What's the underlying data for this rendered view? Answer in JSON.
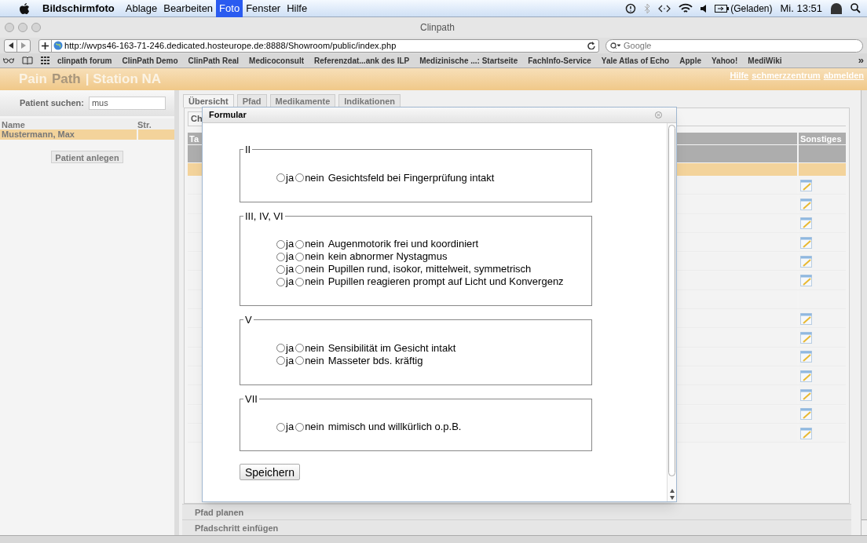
{
  "menu_bar": {
    "app": "Bildschirmfoto",
    "items": [
      {
        "label": "Ablage",
        "selected": false
      },
      {
        "label": "Bearbeiten",
        "selected": false
      },
      {
        "label": "Foto",
        "selected": true
      },
      {
        "label": "Fenster",
        "selected": false
      },
      {
        "label": "Hilfe",
        "selected": false
      }
    ],
    "battery": "(Geladen)",
    "clock": "Mi. 13:51"
  },
  "browser": {
    "title": "Clinpath",
    "url": "http://wvps46-163-71-246.dedicated.hosteurope.de:8888/Showroom/public/index.php",
    "search_placeholder": "Google",
    "bookmarks": [
      "clinpath forum",
      "ClinPath Demo",
      "ClinPath Real",
      "Medicoconsult",
      "Referenzdat...ank des ILP",
      "Medizinische ...: Startseite",
      "FachInfo-Service",
      "Yale Atlas of Echo",
      "Apple",
      "Yahoo!",
      "MediWiki"
    ],
    "more": "»"
  },
  "header": {
    "logo": [
      {
        "text": "Pain",
        "kind": "light"
      },
      {
        "text": "Path",
        "kind": "muted"
      },
      {
        "text": "| Station NA",
        "kind": "light"
      }
    ],
    "links": [
      "Hilfe",
      "schmerzzentrum",
      "abmelden"
    ]
  },
  "sidebar": {
    "search_label": "Patient suchen:",
    "search_value": "mus",
    "columns": [
      "Name",
      "Str."
    ],
    "rows": [
      {
        "name": "Mustermann, Max",
        "str": "",
        "selected": true
      }
    ],
    "button": "Patient anlegen"
  },
  "tabs": [
    {
      "label": "Übersicht",
      "selected": true
    },
    {
      "label": "Pfad",
      "selected": false
    },
    {
      "label": "Medikamente",
      "selected": false
    },
    {
      "label": "Indikationen",
      "selected": false
    }
  ],
  "inner_tab": "Ch",
  "table": {
    "columns": [
      "Ta",
      "Sonstiges"
    ],
    "rows": [
      {
        "selected": true,
        "edit": false
      },
      {
        "selected": false,
        "edit": true
      },
      {
        "selected": false,
        "edit": true
      },
      {
        "selected": false,
        "edit": true
      },
      {
        "selected": false,
        "edit": true
      },
      {
        "selected": false,
        "edit": true
      },
      {
        "selected": false,
        "edit": true
      },
      {
        "selected": false,
        "edit": false
      },
      {
        "selected": false,
        "edit": true
      },
      {
        "selected": false,
        "edit": true
      },
      {
        "selected": false,
        "edit": true
      },
      {
        "selected": false,
        "edit": true
      },
      {
        "selected": false,
        "edit": true
      },
      {
        "selected": false,
        "edit": true
      },
      {
        "selected": false,
        "edit": true
      }
    ]
  },
  "accordion": [
    "Pfad planen",
    "Pfadschritt einfügen"
  ],
  "dialog": {
    "title": "Formular",
    "sections": [
      {
        "legend": "II",
        "items": [
          {
            "options": [
              {
                "label": "ja",
                "selected": false
              },
              {
                "label": "nein",
                "selected": false
              }
            ],
            "text": "Gesichtsfeld bei Fingerprüfung intakt"
          }
        ]
      },
      {
        "legend": "III, IV, VI",
        "items": [
          {
            "options": [
              {
                "label": "ja",
                "selected": false
              },
              {
                "label": "nein",
                "selected": false
              }
            ],
            "text": "Augenmotorik frei und koordiniert"
          },
          {
            "options": [
              {
                "label": "ja",
                "selected": false
              },
              {
                "label": "nein",
                "selected": false
              }
            ],
            "text": "kein abnormer Nystagmus"
          },
          {
            "options": [
              {
                "label": "ja",
                "selected": false
              },
              {
                "label": "nein",
                "selected": false
              }
            ],
            "text": "Pupillen rund, isokor, mittelweit, symmetrisch"
          },
          {
            "options": [
              {
                "label": "ja",
                "selected": false
              },
              {
                "label": "nein",
                "selected": false
              }
            ],
            "text": "Pupillen reagieren prompt auf Licht und Konvergenz"
          }
        ]
      },
      {
        "legend": "V",
        "items": [
          {
            "options": [
              {
                "label": "ja",
                "selected": false
              },
              {
                "label": "nein",
                "selected": false
              }
            ],
            "text": "Sensibilität im Gesicht intakt"
          },
          {
            "options": [
              {
                "label": "ja",
                "selected": false
              },
              {
                "label": "nein",
                "selected": false
              }
            ],
            "text": "Masseter bds. kräftig"
          }
        ]
      },
      {
        "legend": "VII",
        "items": [
          {
            "options": [
              {
                "label": "ja",
                "selected": false
              },
              {
                "label": "nein",
                "selected": false
              }
            ],
            "text": "mimisch und willkürlich o.p.B."
          }
        ]
      }
    ],
    "save": "Speichern"
  }
}
